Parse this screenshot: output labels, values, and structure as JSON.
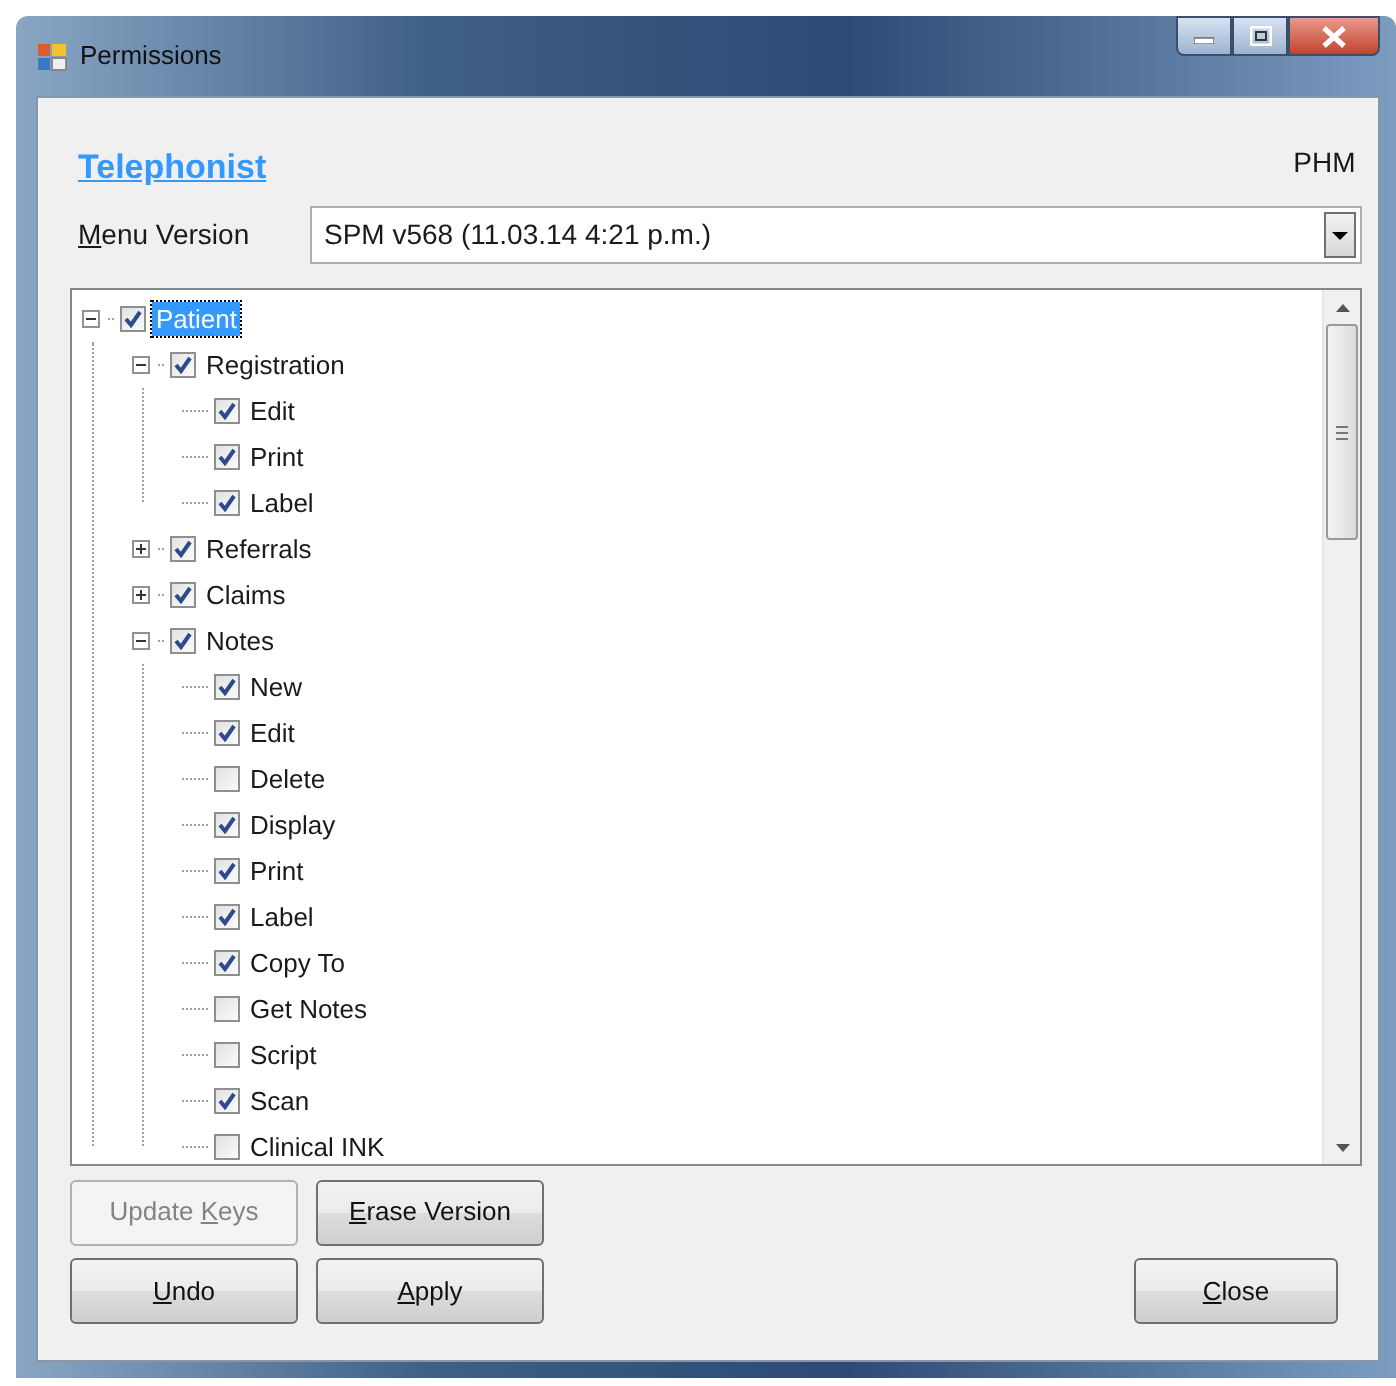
{
  "window": {
    "title": "Permissions"
  },
  "role_link": "Telephonist",
  "user_code": "PHM",
  "menu_version": {
    "label": [
      {
        "text": "M",
        "underlined": true
      },
      {
        "text": "enu Version",
        "underlined": false
      }
    ],
    "value": "SPM v568 (11.03.14 4:21 p.m.)"
  },
  "tree": [
    {
      "label": "Patient",
      "checked": true,
      "selected": true,
      "expanded": true,
      "children": [
        {
          "label": "Registration",
          "checked": true,
          "selected": false,
          "expanded": true,
          "children": [
            {
              "label": "Edit",
              "checked": true,
              "selected": false
            },
            {
              "label": "Print",
              "checked": true,
              "selected": false
            },
            {
              "label": "Label",
              "checked": true,
              "selected": false
            }
          ]
        },
        {
          "label": "Referrals",
          "checked": true,
          "selected": false,
          "expanded": false
        },
        {
          "label": "Claims",
          "checked": true,
          "selected": false,
          "expanded": false
        },
        {
          "label": "Notes",
          "checked": true,
          "selected": false,
          "expanded": true,
          "children": [
            {
              "label": "New",
              "checked": true,
              "selected": false
            },
            {
              "label": "Edit",
              "checked": true,
              "selected": false
            },
            {
              "label": "Delete",
              "checked": false,
              "selected": false
            },
            {
              "label": "Display",
              "checked": true,
              "selected": false
            },
            {
              "label": "Print",
              "checked": true,
              "selected": false
            },
            {
              "label": "Label",
              "checked": true,
              "selected": false
            },
            {
              "label": "Copy To",
              "checked": true,
              "selected": false
            },
            {
              "label": "Get Notes",
              "checked": false,
              "selected": false
            },
            {
              "label": "Script",
              "checked": false,
              "selected": false
            },
            {
              "label": "Scan",
              "checked": true,
              "selected": false
            },
            {
              "label": "Clinical INK",
              "checked": false,
              "selected": false
            }
          ]
        }
      ]
    }
  ],
  "buttons": {
    "upper_left": [
      {
        "label": [
          {
            "text": "Update ",
            "underlined": false
          },
          {
            "text": "K",
            "underlined": true
          },
          {
            "text": "eys",
            "underlined": false
          }
        ],
        "disabled": true
      },
      {
        "label": [
          {
            "text": "E",
            "underlined": true
          },
          {
            "text": "rase Version",
            "underlined": false
          }
        ],
        "disabled": false
      }
    ],
    "lower_left": [
      {
        "label": [
          {
            "text": "U",
            "underlined": true
          },
          {
            "text": "ndo",
            "underlined": false
          }
        ],
        "disabled": false
      },
      {
        "label": [
          {
            "text": "A",
            "underlined": true
          },
          {
            "text": "pply",
            "underlined": false
          }
        ],
        "disabled": false
      }
    ],
    "lower_right": [
      {
        "label": [
          {
            "text": "C",
            "underlined": true
          },
          {
            "text": "lose",
            "underlined": false
          }
        ],
        "disabled": false
      }
    ]
  }
}
